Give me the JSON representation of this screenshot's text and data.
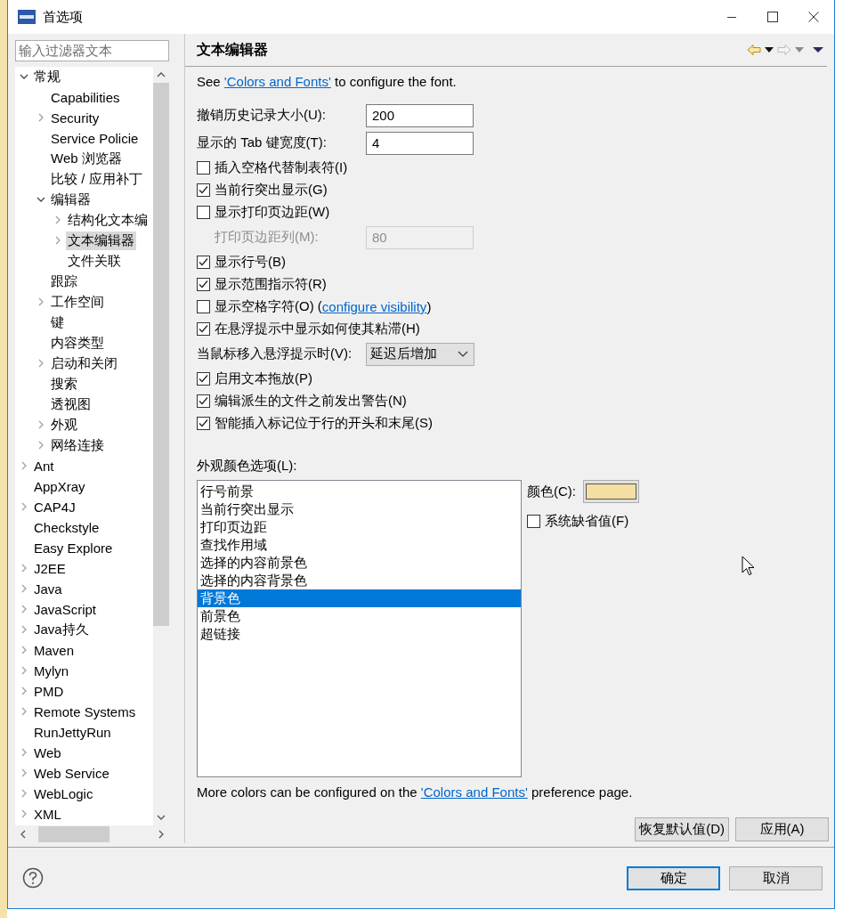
{
  "window": {
    "title": "首选项"
  },
  "filter": {
    "placeholder": "输入过滤器文本"
  },
  "tree": [
    {
      "label": "常规",
      "expanded": true,
      "selected": false,
      "children": [
        {
          "label": "Capabilities",
          "selected": false
        },
        {
          "label": "Security",
          "expanded": false,
          "selected": false
        },
        {
          "label": "Service Policie",
          "selected": false
        },
        {
          "label": "Web 浏览器",
          "selected": false
        },
        {
          "label": "比较 / 应用补丁",
          "selected": false
        },
        {
          "label": "编辑器",
          "expanded": true,
          "selected": false,
          "children": [
            {
              "label": "结构化文本编",
              "expanded": false,
              "selected": false
            },
            {
              "label": "文本编辑器",
              "expanded": false,
              "selected": true
            },
            {
              "label": "文件关联",
              "selected": false
            }
          ]
        },
        {
          "label": "跟踪",
          "selected": false
        },
        {
          "label": "工作空间",
          "expanded": false,
          "selected": false
        },
        {
          "label": "键",
          "selected": false
        },
        {
          "label": "内容类型",
          "selected": false
        },
        {
          "label": "启动和关闭",
          "expanded": false,
          "selected": false
        },
        {
          "label": "搜索",
          "selected": false
        },
        {
          "label": "透视图",
          "selected": false
        },
        {
          "label": "外观",
          "expanded": false,
          "selected": false
        },
        {
          "label": "网络连接",
          "expanded": false,
          "selected": false
        }
      ]
    },
    {
      "label": "Ant",
      "expanded": false,
      "selected": false
    },
    {
      "label": "AppXray",
      "selected": false
    },
    {
      "label": "CAP4J",
      "expanded": false,
      "selected": false
    },
    {
      "label": "Checkstyle",
      "selected": false
    },
    {
      "label": "Easy Explore",
      "selected": false
    },
    {
      "label": "J2EE",
      "expanded": false,
      "selected": false
    },
    {
      "label": "Java",
      "expanded": false,
      "selected": false
    },
    {
      "label": "JavaScript",
      "expanded": false,
      "selected": false
    },
    {
      "label": "Java持久",
      "expanded": false,
      "selected": false
    },
    {
      "label": "Maven",
      "expanded": false,
      "selected": false
    },
    {
      "label": "Mylyn",
      "expanded": false,
      "selected": false
    },
    {
      "label": "PMD",
      "expanded": false,
      "selected": false
    },
    {
      "label": "Remote Systems",
      "expanded": false,
      "selected": false
    },
    {
      "label": "RunJettyRun",
      "selected": false
    },
    {
      "label": "Web",
      "expanded": false,
      "selected": false
    },
    {
      "label": "Web Service",
      "expanded": false,
      "selected": false
    },
    {
      "label": "WebLogic",
      "expanded": false,
      "selected": false
    },
    {
      "label": "XML",
      "expanded": false,
      "selected": false
    }
  ],
  "page": {
    "title": "文本编辑器",
    "intro": {
      "before": "See ",
      "link": "'Colors and Fonts'",
      "after": " to configure the font."
    },
    "options": [
      {
        "kind": "field",
        "label": "撤销历史记录大小(U):",
        "value": "200",
        "disabled": false
      },
      {
        "kind": "field",
        "label": "显示的 Tab 键宽度(T):",
        "value": "4",
        "disabled": false
      },
      {
        "kind": "checkbox",
        "label": "插入空格代替制表符(I)",
        "checked": false
      },
      {
        "kind": "checkbox",
        "label": "当前行突出显示(G)",
        "checked": true
      },
      {
        "kind": "checkbox",
        "label": "显示打印页边距(W)",
        "checked": false
      },
      {
        "kind": "field",
        "label": "打印页边距列(M):",
        "value": "80",
        "disabled": true
      },
      {
        "kind": "checkbox",
        "label": "显示行号(B)",
        "checked": true
      },
      {
        "kind": "checkbox",
        "label": "显示范围指示符(R)",
        "checked": true
      },
      {
        "kind": "checkbox",
        "label": "显示空格字符(O) (",
        "link": "configure visibility",
        "suffix": ")",
        "checked": false
      },
      {
        "kind": "checkbox",
        "label": "在悬浮提示中显示如何使其粘滞(H)",
        "checked": true
      },
      {
        "kind": "select",
        "label": "当鼠标移入悬浮提示时(V):",
        "value": "延迟后增加"
      },
      {
        "kind": "checkbox",
        "label": "启用文本拖放(P)",
        "checked": true
      },
      {
        "kind": "checkbox",
        "label": "编辑派生的文件之前发出警告(N)",
        "checked": true
      },
      {
        "kind": "checkbox",
        "label": "智能插入标记位于行的开头和末尾(S)",
        "checked": true
      }
    ],
    "color_options": {
      "label": "外观颜色选项(L):",
      "items": [
        {
          "label": "行号前景",
          "selected": false
        },
        {
          "label": "当前行突出显示",
          "selected": false
        },
        {
          "label": "打印页边距",
          "selected": false
        },
        {
          "label": "查找作用域",
          "selected": false
        },
        {
          "label": "选择的内容前景色",
          "selected": false
        },
        {
          "label": "选择的内容背景色",
          "selected": false
        },
        {
          "label": "背景色",
          "selected": true
        },
        {
          "label": "前景色",
          "selected": false
        },
        {
          "label": "超链接",
          "selected": false
        }
      ],
      "color_label": "颜色(C):",
      "color": "#f5dea4",
      "system_default": {
        "label": "系统缺省值(F)",
        "checked": false
      }
    },
    "footer_note": {
      "before": "More colors can be configured on the ",
      "link": "'Colors and Fonts'",
      "after": " preference page."
    },
    "buttons": [
      "恢复默认值(D)",
      "应用(A)"
    ]
  },
  "dialog_buttons": [
    {
      "label": "确定",
      "default": true
    },
    {
      "label": "取消",
      "default": false
    }
  ]
}
